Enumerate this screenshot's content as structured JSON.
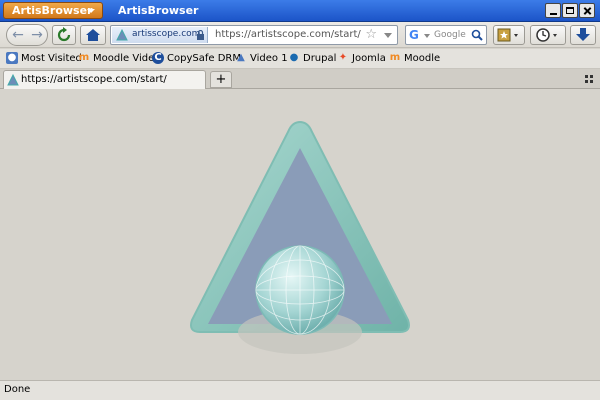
{
  "titlebar": {
    "app_menu_label": "ArtisBrowser",
    "window_title": "ArtisBrowser"
  },
  "navbar": {
    "identity_domain": "artisscope.com",
    "url": "https://artistscope.com/start/",
    "search_placeholder": "Google"
  },
  "bookmarks": [
    {
      "label": "Most Visited",
      "icon": "most-visited-icon"
    },
    {
      "label": "Moodle Video",
      "icon": "moodle-icon"
    },
    {
      "label": "CopySafe DRM",
      "icon": "copysafe-icon"
    },
    {
      "label": "Video 1",
      "icon": "artisbrowser-icon"
    },
    {
      "label": "Drupal",
      "icon": "drupal-icon"
    },
    {
      "label": "Joomla",
      "icon": "joomla-icon"
    },
    {
      "label": "Moodle",
      "icon": "moodle-icon"
    }
  ],
  "tabs": [
    {
      "label": "https://artistscope.com/start/"
    }
  ],
  "status": {
    "text": "Done"
  },
  "colors": {
    "titlebar": "#2a64d8",
    "app_menu": "#e08e2e",
    "logo_frame": "#8ec5bd",
    "logo_fill": "#8a9cb8",
    "logo_globe": "#a6d6d4"
  }
}
